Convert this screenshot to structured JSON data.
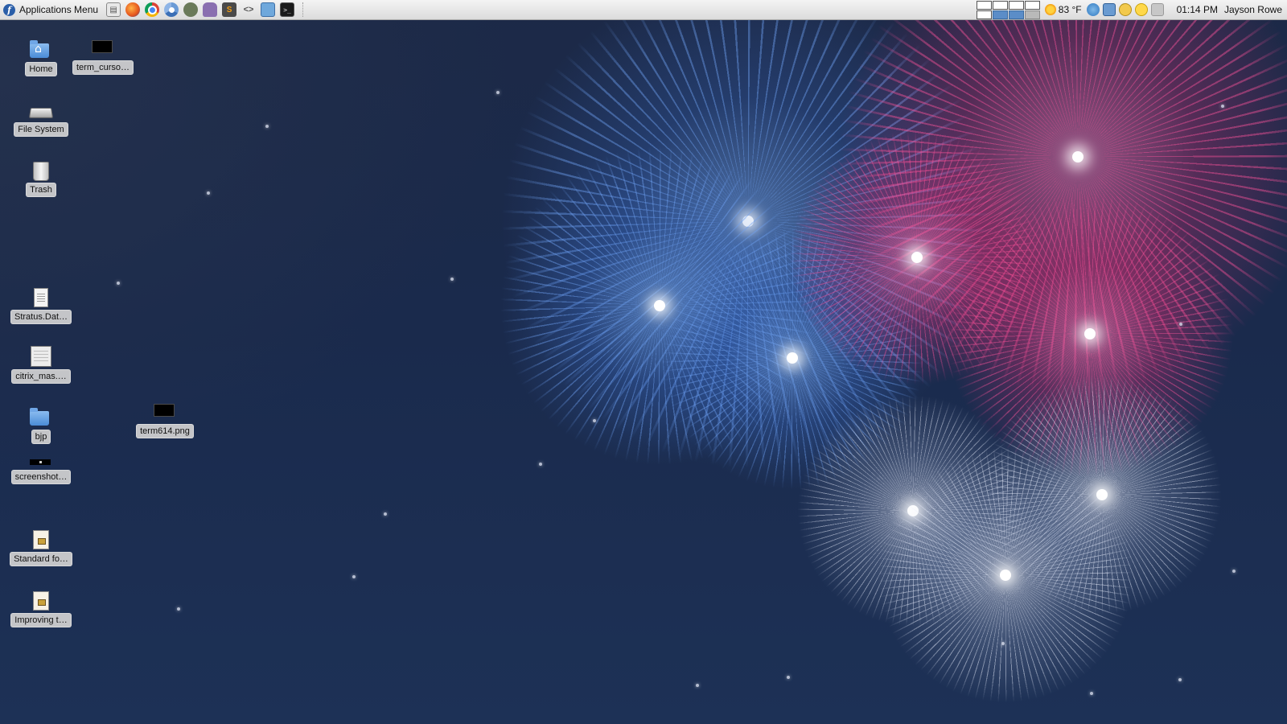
{
  "panel": {
    "app_menu_label": "Applications Menu",
    "launchers": [
      {
        "name": "file-manager-icon"
      },
      {
        "name": "firefox-icon"
      },
      {
        "name": "chrome-icon"
      },
      {
        "name": "chromium-icon"
      },
      {
        "name": "gimp-icon"
      },
      {
        "name": "pidgin-icon"
      },
      {
        "name": "sublime-text-icon"
      },
      {
        "name": "code-editor-icon"
      },
      {
        "name": "screenshot-tool-icon"
      },
      {
        "name": "terminal-icon"
      }
    ],
    "workspaces": {
      "count": 8,
      "active_index": 5
    },
    "weather": {
      "temperature": "83 °F",
      "icon": "sun-icon"
    },
    "clock": "01:14 PM",
    "user": "Jayson Rowe"
  },
  "desktop": {
    "icons": {
      "home": "Home",
      "file_system": "File System",
      "trash": "Trash",
      "term_cursor": "term_curso…",
      "stratus": "Stratus.Dat…",
      "citrix": "citrix_mas.…",
      "bjp": "bjp",
      "term614": "term614.png",
      "screenshot": "screenshot…",
      "standard": "Standard fo…",
      "improving": "Improving t…"
    }
  },
  "colors": {
    "panel_bg": "#dcdcdc",
    "wallpaper_bg": "#1c2947",
    "firework_blue": "#5a8fe0",
    "firework_pink": "#e0408a",
    "firework_white": "#e6ebf7"
  }
}
